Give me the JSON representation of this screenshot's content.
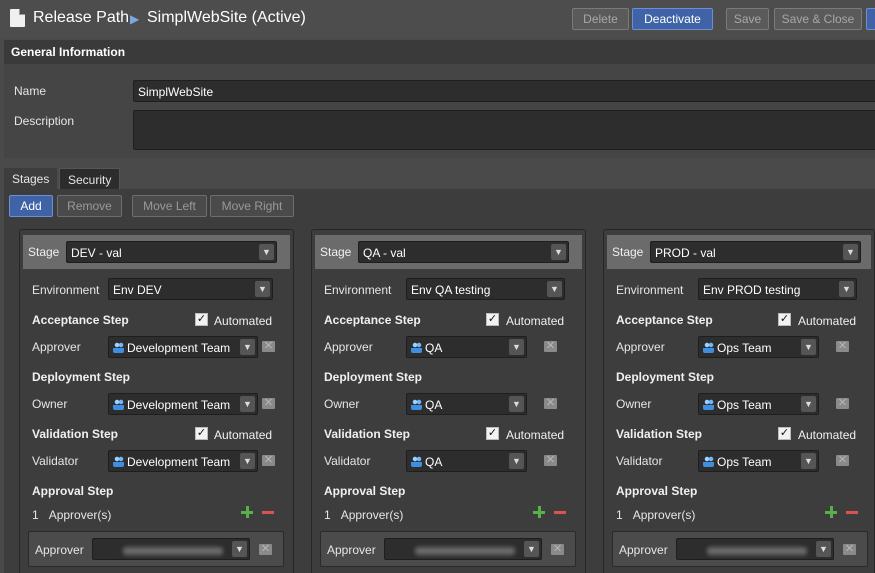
{
  "header": {
    "breadcrumb_root": "Release Path",
    "breadcrumb_separator": "▶",
    "title": "SimplWebSite (Active)",
    "buttons": {
      "delete": "Delete",
      "deactivate": "Deactivate",
      "save": "Save",
      "save_close": "Save & Close"
    }
  },
  "general": {
    "section_title": "General Information",
    "name_label": "Name",
    "name_value": "SimplWebSite",
    "description_label": "Description",
    "description_value": ""
  },
  "tabs": [
    {
      "label": "Stages",
      "active": true
    },
    {
      "label": "Security",
      "active": false
    }
  ],
  "stage_actions": {
    "add": "Add",
    "remove": "Remove",
    "move_left": "Move Left",
    "move_right": "Move Right"
  },
  "labels": {
    "stage": "Stage",
    "environment": "Environment",
    "acceptance_step": "Acceptance Step",
    "automated": "Automated",
    "approver": "Approver",
    "deployment_step": "Deployment Step",
    "owner": "Owner",
    "validation_step": "Validation Step",
    "validator": "Validator",
    "approval_step": "Approval Step",
    "approvers_suffix": "Approver(s)"
  },
  "stages": [
    {
      "stage": "DEV - val",
      "environment": "Env DEV",
      "acceptance_automated": true,
      "approver": "Development Team",
      "owner": "Development Team",
      "validation_automated": true,
      "validator": "Development Team",
      "approval_count": "1"
    },
    {
      "stage": "QA - val",
      "environment": "Env QA testing",
      "acceptance_automated": true,
      "approver": "QA",
      "owner": "QA",
      "validation_automated": true,
      "validator": "QA",
      "approval_count": "1"
    },
    {
      "stage": "PROD - val",
      "environment": "Env PROD testing",
      "acceptance_automated": true,
      "approver": "Ops Team",
      "owner": "Ops Team",
      "validation_automated": true,
      "validator": "Ops Team",
      "approval_count": "1"
    }
  ],
  "icons": {
    "document": "document-icon",
    "group": "group-icon",
    "mail": "mail-icon",
    "add": "plus-icon",
    "remove": "minus-icon",
    "dropdown": "chevron-down-icon"
  },
  "colors": {
    "accent": "#3f63a6",
    "background": "#4a4a4a",
    "panel": "#3d3d3d",
    "plus": "#59b04b",
    "minus": "#d9534f"
  }
}
